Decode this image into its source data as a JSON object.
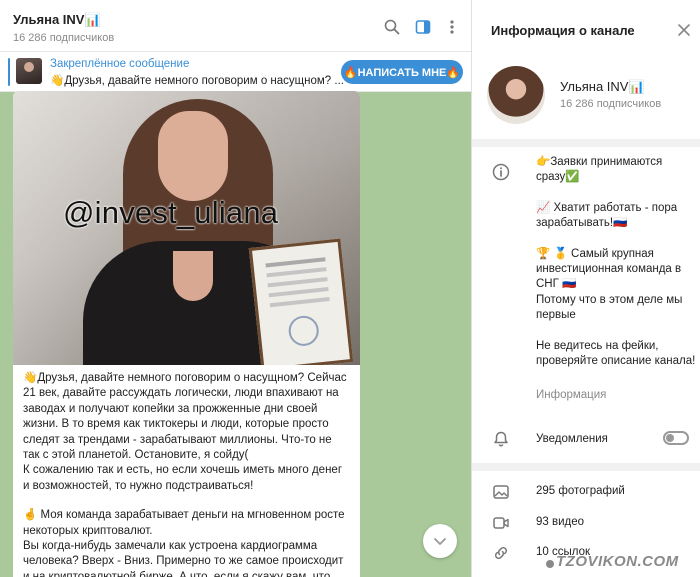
{
  "chat": {
    "title": "Ульяна INV📊",
    "subscribers": "16 286 подписчиков",
    "pinned": {
      "title": "Закреплённое сообщение",
      "text": "👋Друзья, давайте немного поговорим о насущном? ...",
      "cta": "🔥НАПИСАТЬ МНЕ🔥"
    },
    "message": {
      "photo_caption": "@invest_uliana",
      "paragraphs": [
        "👋Друзья, давайте немного поговорим о насущном? Сейчас 21 век, давайте рассуждать логически, люди впахивают на заводах и получают копейки за прожженные дни своей жизни. В то время как тиктокеры и люди, которые просто следят за трендами - зарабатывают миллионы. Что-то не так с этой планетой. Остановите, я сойду(\nК сожалению так и есть, но если хочешь иметь много денег и возможностей, то нужно подстраиваться!",
        "🤞 Моя команда зарабатывает деньги на мгновенном росте некоторых криптовалют.\nВы когда-нибудь замечали как устроена кардиограмма человека? Вверх - Вниз. Примерно то же самое происходит и на криптовалютной бирже. А что, если я скажу вам, что есть такие"
      ]
    }
  },
  "info": {
    "header_title": "Информация о канале",
    "channel_name": "Ульяна INV📊",
    "subscribers": "16 286 подписчиков",
    "description": [
      "👉Заявки принимаются сразу✅",
      "📈 Хватит работать - пора зарабатывать!🇷🇺",
      "🏆 🥇 Самый крупная инвестиционная команда в СНГ 🇷🇺\nПотому что в этом деле мы первые",
      "Не ведитесь на фейки, проверяйте описание канала!"
    ],
    "description_caption": "Информация",
    "notifications_label": "Уведомления",
    "notifications_on": false,
    "media": [
      {
        "label": "295 фотографий",
        "icon": "photo-icon"
      },
      {
        "label": "93 видео",
        "icon": "video-icon"
      },
      {
        "label": "10 ссылок",
        "icon": "link-icon"
      }
    ]
  },
  "watermark": "TZOVIKON.COM",
  "colors": {
    "accent": "#3a8fd6",
    "chat_background": "#a9c99a",
    "muted_text": "#8a8a8a"
  }
}
